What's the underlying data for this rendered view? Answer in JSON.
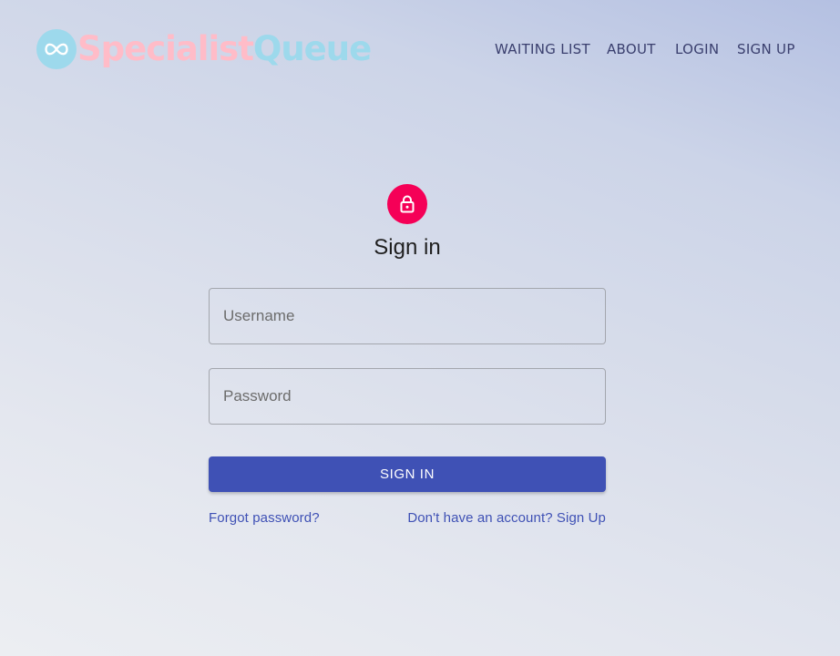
{
  "brand": {
    "icon": "infinity-icon",
    "name_part1": "Specialist",
    "name_part2": "Queue",
    "colors": {
      "pink": "#ffbcc8",
      "cyan": "#9dd9ec"
    }
  },
  "nav": {
    "items": [
      {
        "label": "WAITING LIST"
      },
      {
        "label": "ABOUT"
      },
      {
        "label": "LOGIN"
      },
      {
        "label": "SIGN UP"
      }
    ]
  },
  "signin": {
    "icon": "lock-icon",
    "title": "Sign in",
    "username_placeholder": "Username",
    "password_placeholder": "Password",
    "button_label": "SIGN IN",
    "forgot_label": "Forgot password?",
    "signup_label": "Don't have an account? Sign Up"
  },
  "colors": {
    "primary": "#3f51b5",
    "accent": "#f50057",
    "nav_text": "#3a3f6e"
  }
}
